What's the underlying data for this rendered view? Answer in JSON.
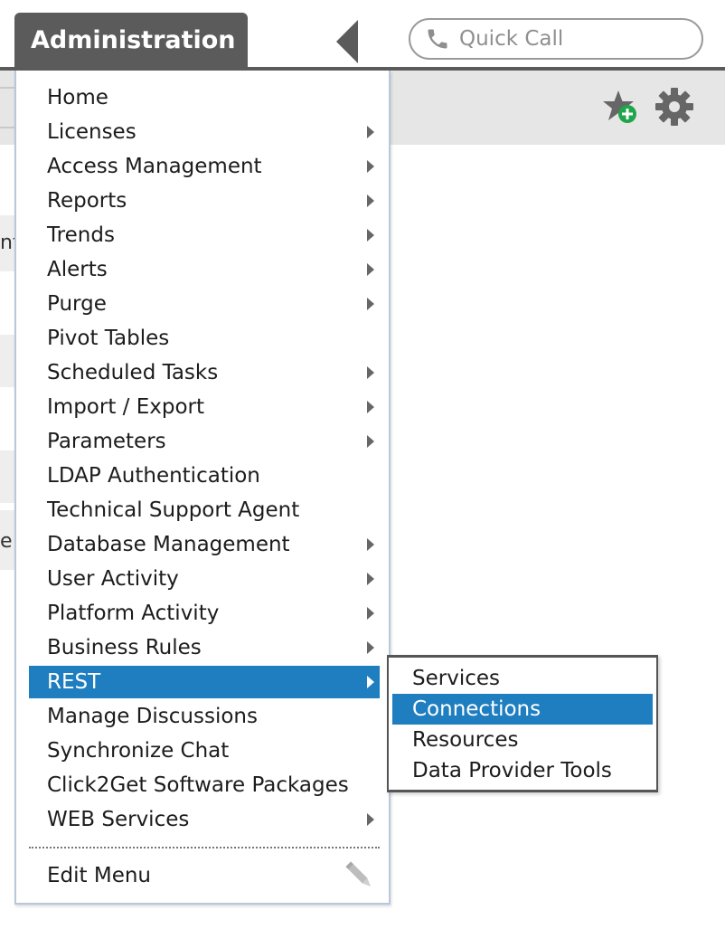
{
  "header": {
    "tab_title": "Administration",
    "quick_call_placeholder": "Quick Call"
  },
  "background": {
    "partial_text_1": "nt",
    "partial_text_2": "e"
  },
  "menu": {
    "items": [
      {
        "label": "Home",
        "has_submenu": false
      },
      {
        "label": "Licenses",
        "has_submenu": true
      },
      {
        "label": "Access Management",
        "has_submenu": true
      },
      {
        "label": "Reports",
        "has_submenu": true
      },
      {
        "label": "Trends",
        "has_submenu": true
      },
      {
        "label": "Alerts",
        "has_submenu": true
      },
      {
        "label": "Purge",
        "has_submenu": true
      },
      {
        "label": "Pivot Tables",
        "has_submenu": false
      },
      {
        "label": "Scheduled Tasks",
        "has_submenu": true
      },
      {
        "label": "Import / Export",
        "has_submenu": true
      },
      {
        "label": "Parameters",
        "has_submenu": true
      },
      {
        "label": "LDAP Authentication",
        "has_submenu": false
      },
      {
        "label": "Technical Support Agent",
        "has_submenu": false
      },
      {
        "label": "Database Management",
        "has_submenu": true
      },
      {
        "label": "User Activity",
        "has_submenu": true
      },
      {
        "label": "Platform Activity",
        "has_submenu": true
      },
      {
        "label": "Business Rules",
        "has_submenu": true
      },
      {
        "label": "REST",
        "has_submenu": true,
        "active": true
      },
      {
        "label": "Manage Discussions",
        "has_submenu": false
      },
      {
        "label": "Synchronize Chat",
        "has_submenu": false
      },
      {
        "label": "Click2Get Software Packages",
        "has_submenu": false
      },
      {
        "label": "WEB Services",
        "has_submenu": true
      }
    ],
    "edit_label": "Edit Menu"
  },
  "submenu": {
    "items": [
      {
        "label": "Services",
        "active": false
      },
      {
        "label": "Connections",
        "active": true
      },
      {
        "label": "Resources",
        "active": false
      },
      {
        "label": "Data Provider Tools",
        "active": false
      }
    ]
  },
  "colors": {
    "accent": "#1f7ec0",
    "tab_bg": "#5b5b5b",
    "add_badge": "#1fa54a"
  },
  "icons": [
    "phone-icon",
    "favorite-add-icon",
    "gear-icon",
    "pencil-icon",
    "chevron-right-icon",
    "collapse-left-icon"
  ]
}
